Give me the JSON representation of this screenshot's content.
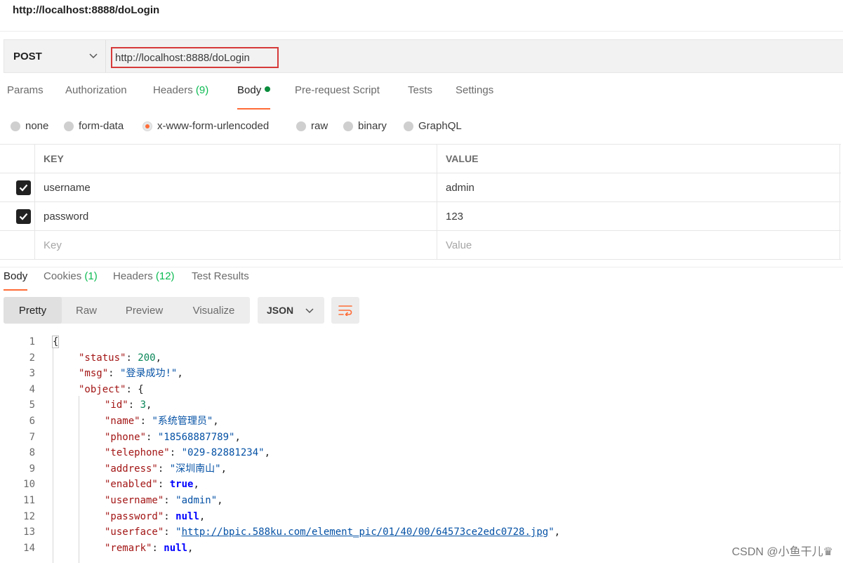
{
  "request": {
    "title": "http://localhost:8888/doLogin",
    "method": "POST",
    "url": "http://localhost:8888/doLogin"
  },
  "request_tabs": [
    {
      "label": "Params"
    },
    {
      "label": "Authorization"
    },
    {
      "label": "Headers",
      "count": "(9)"
    },
    {
      "label": "Body",
      "active": true
    },
    {
      "label": "Pre-request Script"
    },
    {
      "label": "Tests"
    },
    {
      "label": "Settings"
    }
  ],
  "body_types": [
    {
      "label": "none"
    },
    {
      "label": "form-data"
    },
    {
      "label": "x-www-form-urlencoded",
      "selected": true
    },
    {
      "label": "raw"
    },
    {
      "label": "binary"
    },
    {
      "label": "GraphQL"
    }
  ],
  "params_table": {
    "headers": {
      "key": "KEY",
      "value": "VALUE"
    },
    "rows": [
      {
        "checked": true,
        "key": "username",
        "value": "admin"
      },
      {
        "checked": true,
        "key": "password",
        "value": "123"
      }
    ],
    "placeholder": {
      "key": "Key",
      "value": "Value"
    }
  },
  "response_tabs": [
    {
      "label": "Body",
      "active": true
    },
    {
      "label": "Cookies",
      "count": "(1)"
    },
    {
      "label": "Headers",
      "count": "(12)"
    },
    {
      "label": "Test Results"
    }
  ],
  "view_modes": [
    {
      "label": "Pretty",
      "active": true
    },
    {
      "label": "Raw"
    },
    {
      "label": "Preview"
    },
    {
      "label": "Visualize"
    }
  ],
  "format": "JSON",
  "code_lines": [
    {
      "n": "1",
      "indent": 0,
      "tokens": [
        {
          "t": "{",
          "c": "brace"
        }
      ]
    },
    {
      "n": "2",
      "indent": 1,
      "tokens": [
        {
          "t": "\"status\"",
          "c": "key"
        },
        {
          "t": ": ",
          "c": "punc"
        },
        {
          "t": "200",
          "c": "num"
        },
        {
          "t": ",",
          "c": "punc"
        }
      ]
    },
    {
      "n": "3",
      "indent": 1,
      "tokens": [
        {
          "t": "\"msg\"",
          "c": "key"
        },
        {
          "t": ": ",
          "c": "punc"
        },
        {
          "t": "\"登录成功!\"",
          "c": "str"
        },
        {
          "t": ",",
          "c": "punc"
        }
      ]
    },
    {
      "n": "4",
      "indent": 1,
      "tokens": [
        {
          "t": "\"object\"",
          "c": "key"
        },
        {
          "t": ": ",
          "c": "punc"
        },
        {
          "t": "{",
          "c": "punc"
        }
      ]
    },
    {
      "n": "5",
      "indent": 2,
      "tokens": [
        {
          "t": "\"id\"",
          "c": "key"
        },
        {
          "t": ": ",
          "c": "punc"
        },
        {
          "t": "3",
          "c": "num"
        },
        {
          "t": ",",
          "c": "punc"
        }
      ]
    },
    {
      "n": "6",
      "indent": 2,
      "tokens": [
        {
          "t": "\"name\"",
          "c": "key"
        },
        {
          "t": ": ",
          "c": "punc"
        },
        {
          "t": "\"系统管理员\"",
          "c": "str"
        },
        {
          "t": ",",
          "c": "punc"
        }
      ]
    },
    {
      "n": "7",
      "indent": 2,
      "tokens": [
        {
          "t": "\"phone\"",
          "c": "key"
        },
        {
          "t": ": ",
          "c": "punc"
        },
        {
          "t": "\"18568887789\"",
          "c": "str"
        },
        {
          "t": ",",
          "c": "punc"
        }
      ]
    },
    {
      "n": "8",
      "indent": 2,
      "tokens": [
        {
          "t": "\"telephone\"",
          "c": "key"
        },
        {
          "t": ": ",
          "c": "punc"
        },
        {
          "t": "\"029-82881234\"",
          "c": "str"
        },
        {
          "t": ",",
          "c": "punc"
        }
      ]
    },
    {
      "n": "9",
      "indent": 2,
      "tokens": [
        {
          "t": "\"address\"",
          "c": "key"
        },
        {
          "t": ": ",
          "c": "punc"
        },
        {
          "t": "\"深圳南山\"",
          "c": "str"
        },
        {
          "t": ",",
          "c": "punc"
        }
      ]
    },
    {
      "n": "10",
      "indent": 2,
      "tokens": [
        {
          "t": "\"enabled\"",
          "c": "key"
        },
        {
          "t": ": ",
          "c": "punc"
        },
        {
          "t": "true",
          "c": "kw"
        },
        {
          "t": ",",
          "c": "punc"
        }
      ]
    },
    {
      "n": "11",
      "indent": 2,
      "tokens": [
        {
          "t": "\"username\"",
          "c": "key"
        },
        {
          "t": ": ",
          "c": "punc"
        },
        {
          "t": "\"admin\"",
          "c": "str"
        },
        {
          "t": ",",
          "c": "punc"
        }
      ]
    },
    {
      "n": "12",
      "indent": 2,
      "tokens": [
        {
          "t": "\"password\"",
          "c": "key"
        },
        {
          "t": ": ",
          "c": "punc"
        },
        {
          "t": "null",
          "c": "kw"
        },
        {
          "t": ",",
          "c": "punc"
        }
      ]
    },
    {
      "n": "13",
      "indent": 2,
      "tokens": [
        {
          "t": "\"userface\"",
          "c": "key"
        },
        {
          "t": ": ",
          "c": "punc"
        },
        {
          "t": "\"",
          "c": "str"
        },
        {
          "t": "http://bpic.588ku.com/element_pic/01/40/00/64573ce2edc0728.jpg",
          "c": "link"
        },
        {
          "t": "\"",
          "c": "str"
        },
        {
          "t": ",",
          "c": "punc"
        }
      ]
    },
    {
      "n": "14",
      "indent": 2,
      "tokens": [
        {
          "t": "\"remark\"",
          "c": "key"
        },
        {
          "t": ": ",
          "c": "punc"
        },
        {
          "t": "null",
          "c": "kw"
        },
        {
          "t": ",",
          "c": "punc"
        }
      ]
    }
  ],
  "watermark": "CSDN @小鱼干儿♛",
  "colors": {
    "accent": "#ff6c37",
    "url_highlight": "#d63a3a",
    "count_green": "#0cbb52",
    "body_dot": "#0a8c3c"
  },
  "icons": {
    "method_dropdown": "chevron-down-icon",
    "format_dropdown": "chevron-down-icon",
    "wrap": "wrap-lines-icon",
    "checkbox": "check-icon"
  }
}
